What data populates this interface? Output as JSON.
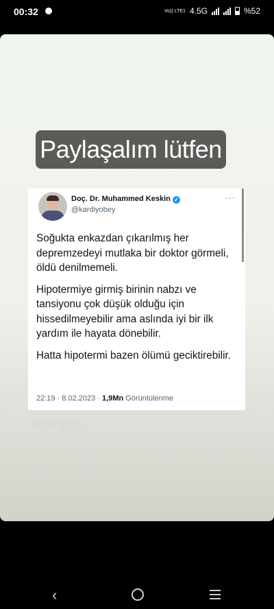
{
  "status": {
    "time": "00:32",
    "network_label": "Vo)) LTE1",
    "network": "4.5G",
    "battery": "%52"
  },
  "story": {
    "caption": "Paylaşalım lütfen",
    "tweet": {
      "author_name": "Doç. Dr. Muhammed Keskin",
      "handle": "@kardiyobey",
      "paragraphs": [
        "Soğukta enkazdan çıkarılmış her depremzedeyi mutlaka bir doktor görmeli, öldü denilmemeli.",
        "Hipotermiye girmiş birinin nabzı ve tansiyonu çok düşük olduğu için hissedilmeyebilir ama aslında iyi bir ilk yardım ile hayata dönebilir.",
        "Hatta hipotermi bazen ölümü geciktirebilir."
      ],
      "timestamp": "22:19 · 8.02.2023 ·",
      "views_count": "1,9Mn",
      "views_label": "Görüntülenme"
    },
    "watermark": "@pozitifgirisim"
  },
  "icons": {
    "verified": "verified-badge-icon",
    "more": "more-options-icon"
  }
}
